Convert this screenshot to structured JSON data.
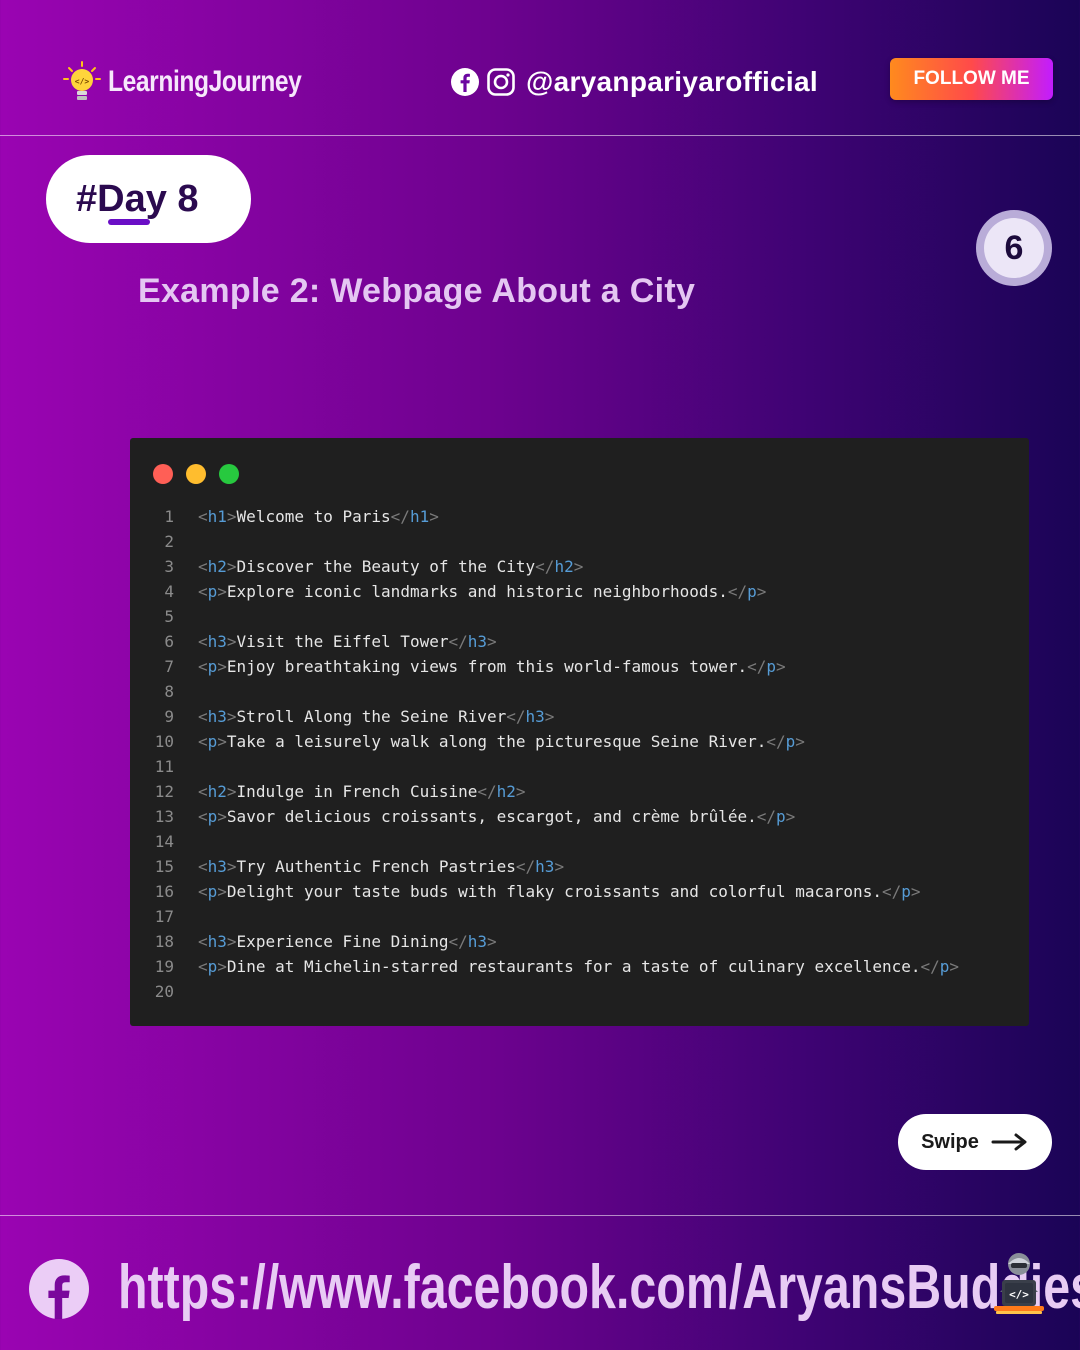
{
  "header": {
    "brand_name": "LearningJourney",
    "social_handle": "@aryanpariyarofficial",
    "follow_label": "FOLLOW ME",
    "icons": [
      "lightbulb-code-icon",
      "facebook-icon",
      "instagram-icon"
    ]
  },
  "day_badge": {
    "label": "#Day 8"
  },
  "page_number": "6",
  "slide_title": "Example 2: Webpage About a City",
  "code_window": {
    "dots": [
      "#ff5f56",
      "#ffbd2e",
      "#27c93f"
    ],
    "lines": [
      {
        "n": "1",
        "tag": "h1",
        "text": "Welcome to Paris"
      },
      {
        "n": "2",
        "tag": "",
        "text": ""
      },
      {
        "n": "3",
        "tag": "h2",
        "text": "Discover the Beauty of the City"
      },
      {
        "n": "4",
        "tag": "p",
        "text": "Explore iconic landmarks and historic neighborhoods."
      },
      {
        "n": "5",
        "tag": "",
        "text": ""
      },
      {
        "n": "6",
        "tag": "h3",
        "text": "Visit the Eiffel Tower"
      },
      {
        "n": "7",
        "tag": "p",
        "text": "Enjoy breathtaking views from this world-famous tower."
      },
      {
        "n": "8",
        "tag": "",
        "text": ""
      },
      {
        "n": "9",
        "tag": "h3",
        "text": "Stroll Along the Seine River"
      },
      {
        "n": "10",
        "tag": "p",
        "text": "Take a leisurely walk along the picturesque Seine River."
      },
      {
        "n": "11",
        "tag": "",
        "text": ""
      },
      {
        "n": "12",
        "tag": "h2",
        "text": "Indulge in French Cuisine"
      },
      {
        "n": "13",
        "tag": "p",
        "text": "Savor delicious croissants, escargot, and crème brûlée."
      },
      {
        "n": "14",
        "tag": "",
        "text": ""
      },
      {
        "n": "15",
        "tag": "h3",
        "text": "Try Authentic French Pastries"
      },
      {
        "n": "16",
        "tag": "p",
        "text": "Delight your taste buds with flaky croissants and colorful macarons."
      },
      {
        "n": "17",
        "tag": "",
        "text": ""
      },
      {
        "n": "18",
        "tag": "h3",
        "text": "Experience Fine Dining"
      },
      {
        "n": "19",
        "tag": "p",
        "text": "Dine at Michelin-starred restaurants for a taste of culinary excellence."
      },
      {
        "n": "20",
        "tag": "",
        "text": ""
      }
    ],
    "colors": {
      "tag_name": "#569cd6",
      "bracket": "#7a7a7a",
      "text": "#e6e6e6",
      "line_number": "#8b8b8b"
    }
  },
  "swipe": {
    "label": "Swipe",
    "icon": "arrow-right-icon"
  },
  "footer": {
    "url": "https://www.facebook.com/AryansBuddies",
    "icons": [
      "facebook-icon",
      "coder-avatar-icon"
    ]
  }
}
